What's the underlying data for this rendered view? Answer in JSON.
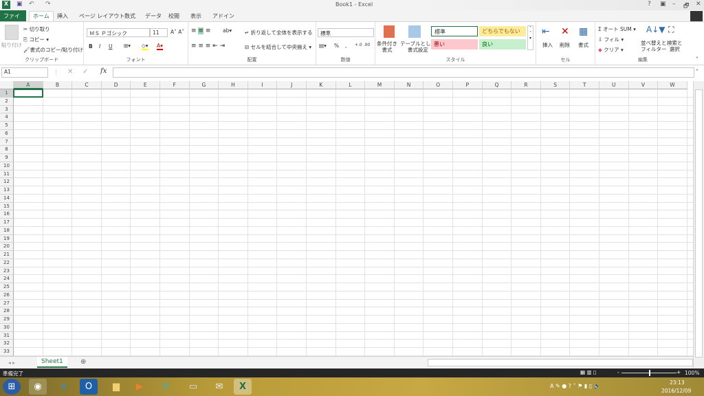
{
  "window": {
    "title": "Book1 - Excel",
    "help": "?",
    "minimize": "–",
    "restore": "🗗",
    "close": "✕"
  },
  "quick_access": {
    "save": "save-icon",
    "undo": "↶",
    "redo": "↷"
  },
  "tabs": [
    {
      "label": "ファイル"
    },
    {
      "label": "ホーム"
    },
    {
      "label": "挿入"
    },
    {
      "label": "ページ レイアウト"
    },
    {
      "label": "数式"
    },
    {
      "label": "データ"
    },
    {
      "label": "校閲"
    },
    {
      "label": "表示"
    },
    {
      "label": "アドイン"
    }
  ],
  "ribbon": {
    "clipboard": {
      "label": "クリップボード",
      "paste": "貼り付け",
      "cut": "切り取り",
      "copy": "コピー",
      "format_painter": "書式のコピー/貼り付け"
    },
    "font": {
      "label": "フォント",
      "font_name": "ＭＳ Ｐゴシック",
      "font_size": "11",
      "bold": "B",
      "italic": "I",
      "underline": "U"
    },
    "alignment": {
      "label": "配置",
      "wrap": "折り返して全体を表示する",
      "merge": "セルを結合して中央揃え"
    },
    "number": {
      "label": "数値",
      "format": "標準",
      "percent": "%",
      "comma": ","
    },
    "styles": {
      "label": "スタイル",
      "conditional": "条件付き\n書式",
      "table": "テーブルとして\n書式設定",
      "normal": "標準",
      "neutral": "どちらでもない",
      "bad": "悪い",
      "good": "良い"
    },
    "cells": {
      "label": "セル",
      "insert": "挿入",
      "delete": "削除",
      "format": "書式"
    },
    "editing": {
      "label": "編集",
      "autosum": "オート SUM",
      "fill": "フィル",
      "clear": "クリア",
      "sort": "並べ替えと\nフィルター",
      "find": "検索と\n選択"
    }
  },
  "formula_bar": {
    "name_box": "A1",
    "fx": "fx",
    "value": ""
  },
  "grid": {
    "columns": [
      "A",
      "B",
      "C",
      "D",
      "E",
      "F",
      "G",
      "H",
      "I",
      "J",
      "K",
      "L",
      "M",
      "N",
      "O",
      "P",
      "Q",
      "R",
      "S",
      "T",
      "U",
      "V",
      "W"
    ],
    "rows": [
      "1",
      "2",
      "3",
      "4",
      "5",
      "6",
      "7",
      "8",
      "9",
      "10",
      "11",
      "12",
      "13",
      "14",
      "15",
      "16",
      "17",
      "18",
      "19",
      "20",
      "21",
      "22",
      "23",
      "24",
      "25",
      "26",
      "27",
      "28",
      "29",
      "30",
      "31",
      "32",
      "33"
    ],
    "selected": "A1"
  },
  "sheets": [
    {
      "label": "Sheet1"
    }
  ],
  "status": {
    "text": "準備完了",
    "zoom": "100%",
    "zoom_level": 100
  },
  "taskbar": {
    "time": "23:13",
    "date": "2016/12/09"
  },
  "colors": {
    "accent": "#217346",
    "bad_bg": "#ffc7ce",
    "good_bg": "#c6efce",
    "neutral_bg": "#ffeb9c"
  }
}
